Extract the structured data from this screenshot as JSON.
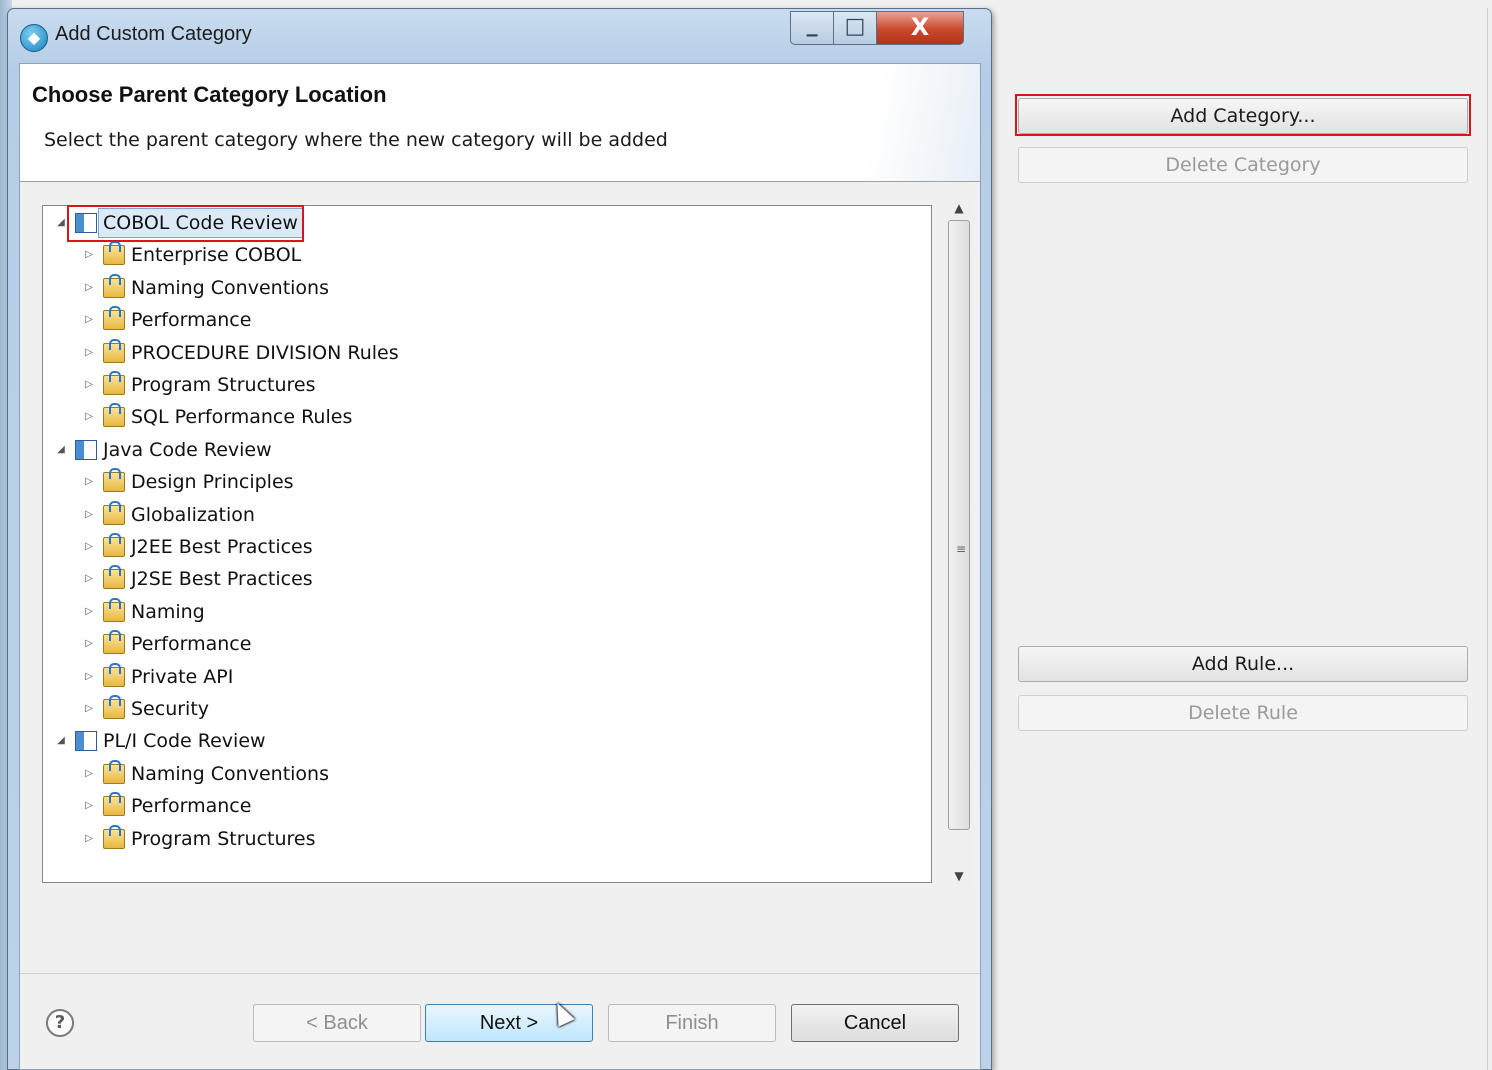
{
  "window": {
    "title": "Add Custom Category",
    "min_glyph": "▁",
    "max_glyph": "□",
    "close_glyph": "X"
  },
  "header": {
    "title": "Choose Parent Category Location",
    "description": "Select the parent category where the new category will be added"
  },
  "tree": {
    "rows": [
      {
        "label": "COBOL Code Review",
        "level": 0,
        "expanded": true,
        "icon": "category-icon",
        "selected": true
      },
      {
        "label": "Enterprise COBOL",
        "level": 1,
        "icon": "folder-icon"
      },
      {
        "label": "Naming Conventions",
        "level": 1,
        "icon": "folder-icon"
      },
      {
        "label": "Performance",
        "level": 1,
        "icon": "folder-icon"
      },
      {
        "label": "PROCEDURE DIVISION Rules",
        "level": 1,
        "icon": "folder-icon"
      },
      {
        "label": "Program Structures",
        "level": 1,
        "icon": "folder-icon"
      },
      {
        "label": "SQL Performance Rules",
        "level": 1,
        "icon": "folder-icon"
      },
      {
        "label": "Java Code Review",
        "level": 0,
        "expanded": true,
        "icon": "category-icon"
      },
      {
        "label": "Design Principles",
        "level": 1,
        "icon": "folder-icon"
      },
      {
        "label": "Globalization",
        "level": 1,
        "icon": "folder-icon"
      },
      {
        "label": "J2EE Best Practices",
        "level": 1,
        "icon": "folder-icon"
      },
      {
        "label": "J2SE Best Practices",
        "level": 1,
        "icon": "folder-icon"
      },
      {
        "label": "Naming",
        "level": 1,
        "icon": "folder-icon"
      },
      {
        "label": "Performance",
        "level": 1,
        "icon": "folder-icon"
      },
      {
        "label": "Private API",
        "level": 1,
        "icon": "folder-icon"
      },
      {
        "label": "Security",
        "level": 1,
        "icon": "folder-icon"
      },
      {
        "label": "PL/I Code Review",
        "level": 0,
        "expanded": true,
        "icon": "category-icon"
      },
      {
        "label": "Naming Conventions",
        "level": 1,
        "icon": "folder-icon"
      },
      {
        "label": "Performance",
        "level": 1,
        "icon": "folder-icon"
      },
      {
        "label": "Program Structures",
        "level": 1,
        "icon": "folder-icon"
      }
    ]
  },
  "footer": {
    "help_glyph": "?",
    "back_label": "< Back",
    "next_label": "Next >",
    "finish_label": "Finish",
    "cancel_label": "Cancel"
  },
  "side_panel": {
    "add_category_label": "Add Category...",
    "delete_category_label": "Delete Category",
    "add_rule_label": "Add Rule...",
    "delete_rule_label": "Delete Rule"
  },
  "colors": {
    "highlight": "#d9141b",
    "selection": "#dceaf8",
    "title_bar": "#b5cde6"
  }
}
